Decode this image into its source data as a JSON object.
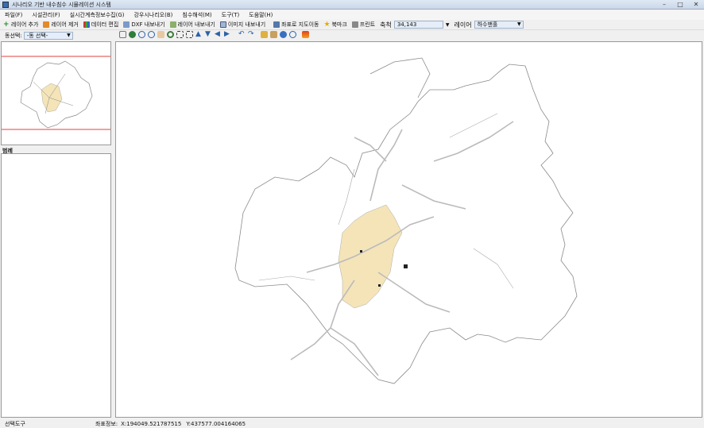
{
  "window": {
    "title": "시나리오 기반 내수침수 시뮬레이션 시스템",
    "minimize": "–",
    "maximize": "□",
    "close": "✕"
  },
  "menu": [
    "파일(F)",
    "시설관리(F)",
    "실시간계측정보수집(G)",
    "강우시나리오(B)",
    "침수해석(M)",
    "도구(T)",
    "도움말(H)"
  ],
  "toolbar": {
    "add_layer": "레이어 추가",
    "remove_layer": "레이어 제거",
    "edit_data": "데이터 편집",
    "export_dxf": "DXF 내보내기",
    "export_layer": "레이어 내보내기",
    "export_image": "이미지 내보내기",
    "goto_coord": "좌표로 지도이동",
    "bookmark": "북마크",
    "print": "프린트",
    "scale_label": "축척",
    "scale_value": "34,143",
    "layer_label": "레이어",
    "layer_value": "하수맨홀"
  },
  "dong": {
    "label": "동선택:",
    "value": "-동 선택-"
  },
  "legend": {
    "title": "범례"
  },
  "status": {
    "tool": "선택도구",
    "coord_label": "좌표정보:",
    "x": "X:194049.521787515",
    "y": "Y:437577.004164065"
  },
  "colors": {
    "urban": "#f4e4b8",
    "boundary": "#8a8a8a",
    "road": "#bbbbbb",
    "extent": "#e0403a"
  }
}
